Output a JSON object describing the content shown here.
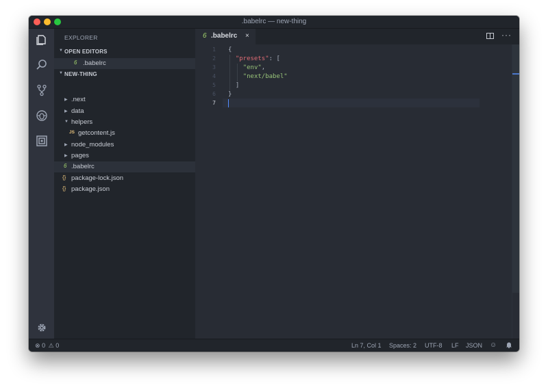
{
  "window": {
    "title": ".babelrc — new-thing"
  },
  "activity_bar": {
    "icons": [
      "files-icon",
      "search-icon",
      "source-control-icon",
      "debug-icon",
      "extensions-icon",
      "gear-icon"
    ]
  },
  "sidebar": {
    "title": "EXPLORER",
    "open_editors": {
      "label": "OPEN EDITORS",
      "items": [
        {
          "name": ".babelrc",
          "icon": "6"
        }
      ]
    },
    "project": {
      "label": "NEW-THING",
      "items": [
        {
          "name": ".next",
          "type": "folder",
          "expanded": false
        },
        {
          "name": "data",
          "type": "folder",
          "expanded": false
        },
        {
          "name": "helpers",
          "type": "folder",
          "expanded": true
        },
        {
          "name": "getcontent.js",
          "type": "file",
          "icon": "JS"
        },
        {
          "name": "node_modules",
          "type": "folder",
          "expanded": false
        },
        {
          "name": "pages",
          "type": "folder",
          "expanded": false
        },
        {
          "name": ".babelrc",
          "type": "file",
          "icon": "6",
          "selected": true
        },
        {
          "name": "package-lock.json",
          "type": "file",
          "icon": "{}"
        },
        {
          "name": "package.json",
          "type": "file",
          "icon": "{}"
        }
      ]
    }
  },
  "editor": {
    "tab": {
      "label": ".babelrc",
      "icon": "6",
      "close": "×"
    },
    "more": "···",
    "line_numbers": [
      "1",
      "2",
      "3",
      "4",
      "5",
      "6",
      "7"
    ],
    "current_line": 7,
    "lines": [
      {
        "parts": [
          {
            "t": "{",
            "c": "punc"
          }
        ]
      },
      {
        "parts": [
          {
            "t": "  ",
            "c": "punc"
          },
          {
            "t": "\"presets\"",
            "c": "key"
          },
          {
            "t": ": [",
            "c": "punc"
          }
        ]
      },
      {
        "parts": [
          {
            "t": "    ",
            "c": "punc"
          },
          {
            "t": "\"env\"",
            "c": "str"
          },
          {
            "t": ",",
            "c": "punc"
          }
        ]
      },
      {
        "parts": [
          {
            "t": "    ",
            "c": "punc"
          },
          {
            "t": "\"next/babel\"",
            "c": "str"
          }
        ]
      },
      {
        "parts": [
          {
            "t": "  ]",
            "c": "punc"
          }
        ]
      },
      {
        "parts": [
          {
            "t": "}",
            "c": "punc"
          }
        ]
      },
      {
        "parts": []
      }
    ]
  },
  "statusbar": {
    "errors": "0",
    "warnings": "0",
    "cursor": "Ln 7, Col 1",
    "spaces": "Spaces: 2",
    "encoding": "UTF-8",
    "eol": "LF",
    "language": "JSON"
  },
  "colors": {
    "folder_arrow": "#9da5b4",
    "babel_icon": "#a3d36e",
    "js_icon": "#e5c07b",
    "json_icon": "#e5c07b",
    "string": "#98c379",
    "key": "#e06c75"
  }
}
